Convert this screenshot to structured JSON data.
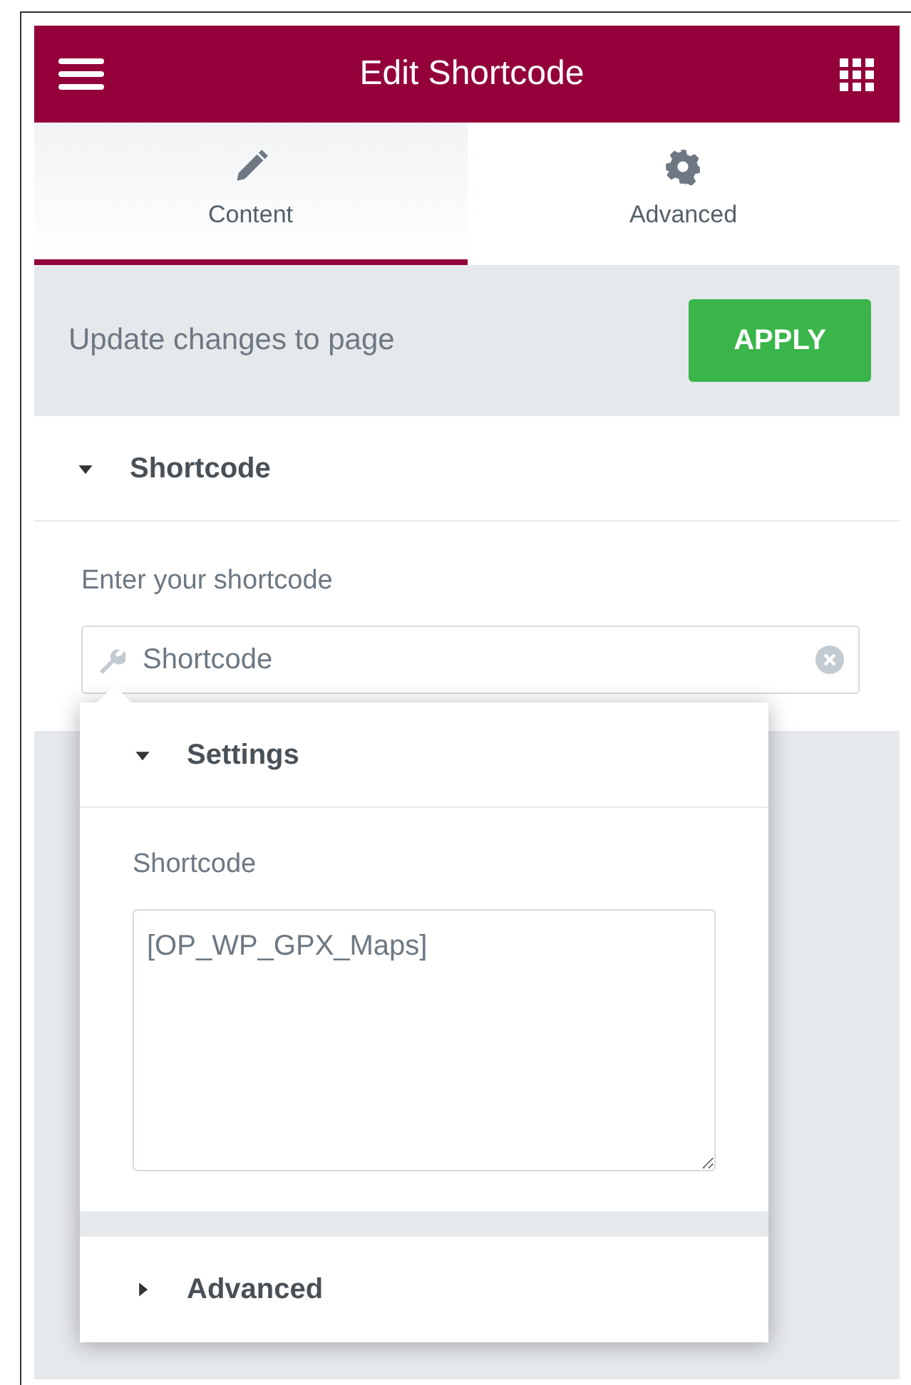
{
  "header": {
    "title": "Edit Shortcode"
  },
  "tabs": [
    {
      "label": "Content",
      "selected": true
    },
    {
      "label": "Advanced",
      "selected": false
    }
  ],
  "apply_bar": {
    "text": "Update changes to page",
    "button": "APPLY"
  },
  "section": {
    "title": "Shortcode",
    "expanded": true,
    "label": "Enter your shortcode",
    "field_value": "Shortcode"
  },
  "popover": {
    "sections": [
      {
        "title": "Settings",
        "expanded": true,
        "label": "Shortcode",
        "value": "[OP_WP_GPX_Maps]"
      },
      {
        "title": "Advanced",
        "expanded": false
      }
    ]
  }
}
